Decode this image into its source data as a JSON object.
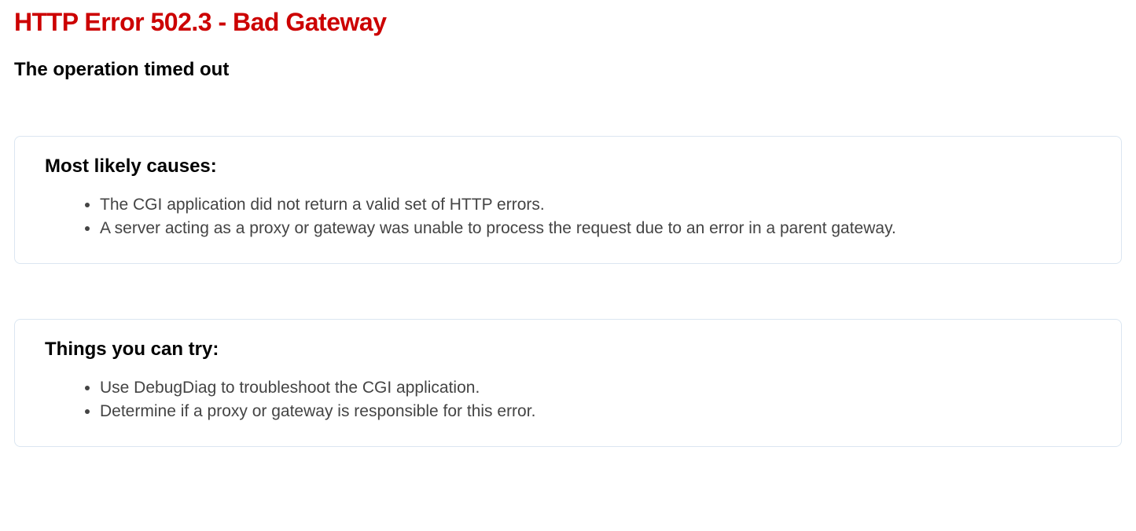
{
  "error": {
    "title": "HTTP Error 502.3 - Bad Gateway",
    "subtitle": "The operation timed out"
  },
  "causes": {
    "heading": "Most likely causes:",
    "items": [
      "The CGI application did not return a valid set of HTTP errors.",
      "A server acting as a proxy or gateway was unable to process the request due to an error in a parent gateway."
    ]
  },
  "tries": {
    "heading": "Things you can try:",
    "items": [
      "Use DebugDiag to troubleshoot the CGI application.",
      "Determine if a proxy or gateway is responsible for this error."
    ]
  }
}
